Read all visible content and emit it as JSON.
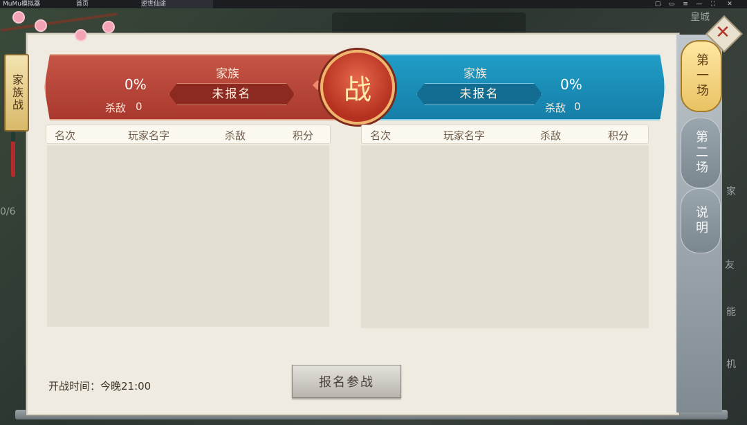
{
  "emulator": {
    "app_title": "MuMu模拟器",
    "tab1": "首页",
    "tab2": "逆世仙途"
  },
  "background": {
    "label_top": "皇城",
    "label_right1": "家",
    "label_right2": "友",
    "label_right3": "能",
    "label_right4": "机",
    "label_left": "0/6"
  },
  "left_tag": {
    "label": "家族战"
  },
  "vs_icon": {
    "label": "战"
  },
  "red_team": {
    "title": "家族",
    "name": "未报名",
    "percent": "0%",
    "kills_label": "杀敌",
    "kills_value": "0",
    "color": "#b5402f"
  },
  "blue_team": {
    "title": "家族",
    "name": "未报名",
    "percent": "0%",
    "kills_label": "杀敌",
    "kills_value": "0",
    "color": "#1b8fbc"
  },
  "table": {
    "headers": [
      "名次",
      "玩家名字",
      "杀敌",
      "积分"
    ],
    "left_rows": [],
    "right_rows": []
  },
  "footer": {
    "start_time": "开战时间：今晚21:00",
    "join_button": "报名参战"
  },
  "right_tabs": {
    "tab1": "第一场",
    "tab2": "第二场",
    "tab3": "说明",
    "active": "第一场"
  },
  "close_button": {
    "label": "✕"
  }
}
